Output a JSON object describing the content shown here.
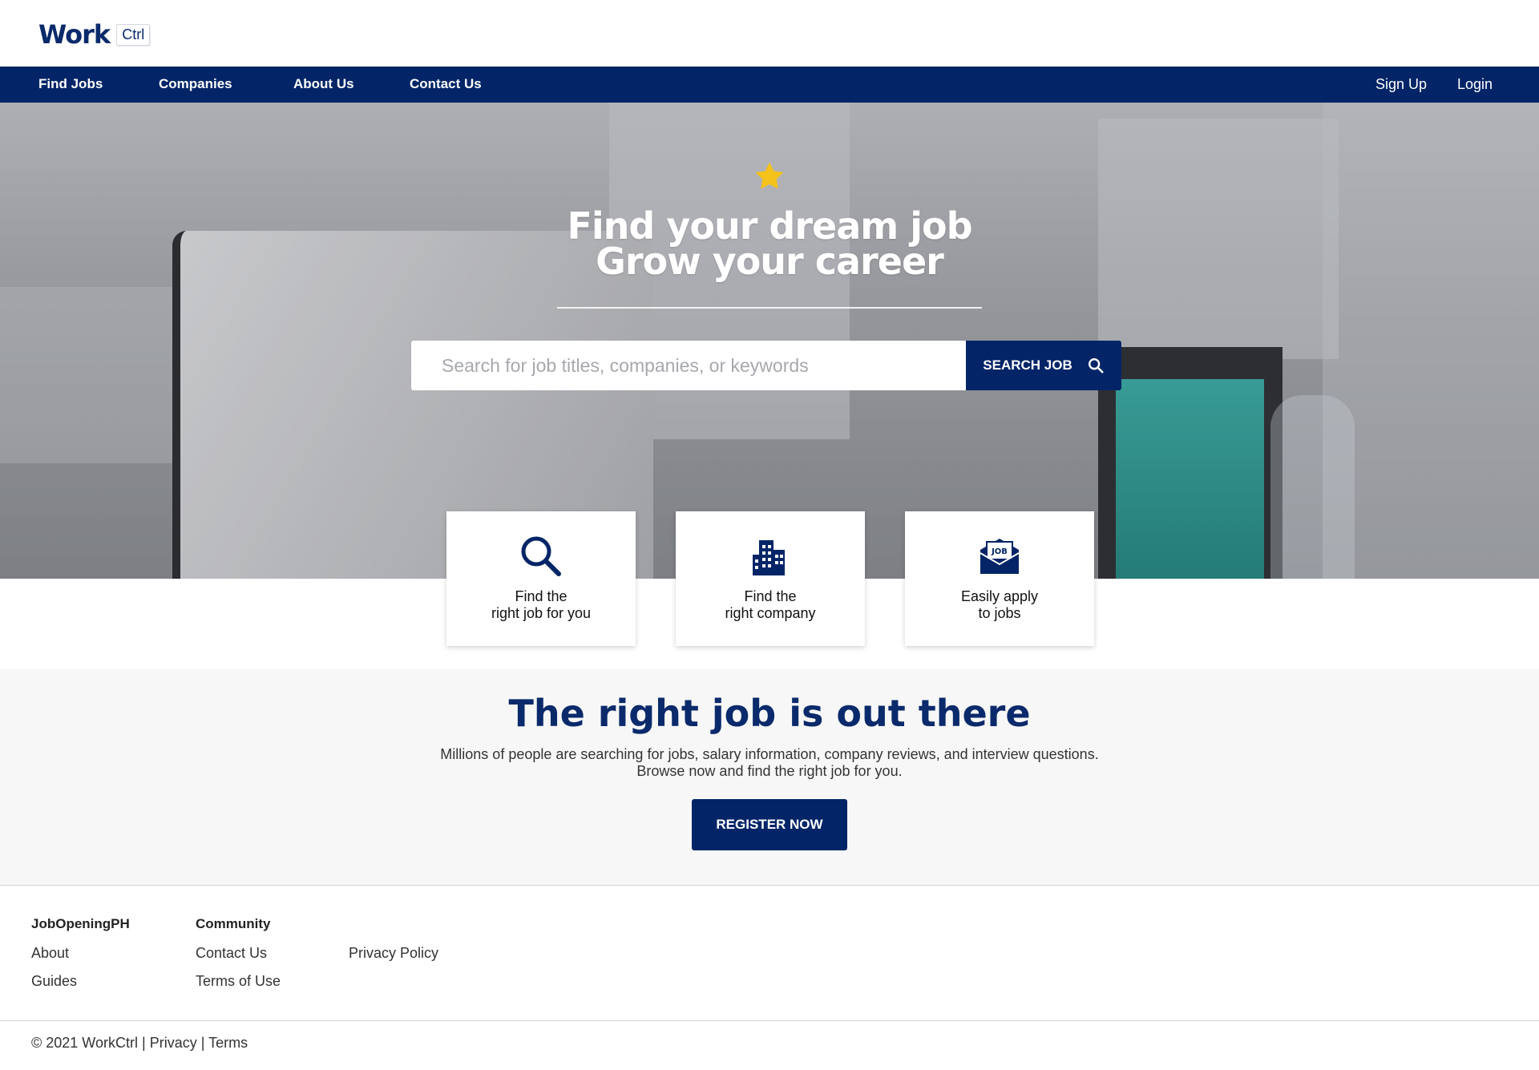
{
  "brand": {
    "name": "Work",
    "badge": "Ctrl"
  },
  "nav": {
    "items": [
      "Find Jobs",
      "Companies",
      "About Us",
      "Contact Us"
    ],
    "signup": "Sign Up",
    "login": "Login"
  },
  "hero": {
    "title_line1": "Find your dream job",
    "title_line2": "Grow your career",
    "search_placeholder": "Search for job titles, companies, or keywords",
    "search_button": "SEARCH JOB"
  },
  "features": [
    {
      "icon": "magnifier-icon",
      "label": "Find the\nright job for you"
    },
    {
      "icon": "building-icon",
      "label": "Find the\nright company"
    },
    {
      "icon": "job-envelope-icon",
      "label": "Easily apply\nto jobs",
      "badge": "JOB"
    }
  ],
  "promo": {
    "heading": "The right job is out there",
    "line1": "Millions of people are searching for jobs, salary information, company reviews, and interview questions.",
    "line2": "Browse now and find the right job for you.",
    "button": "REGISTER NOW"
  },
  "footer": {
    "col1": {
      "heading": "JobOpeningPH",
      "links": [
        "About",
        "Guides"
      ]
    },
    "col2": {
      "heading": "Community",
      "links": [
        "Contact Us",
        "Terms of Use"
      ]
    },
    "col3": {
      "links": [
        "Privacy Policy"
      ]
    },
    "copyright": "© 2021 WorkCtrl",
    "privacy": "Privacy",
    "terms": "Terms",
    "separator": "|"
  },
  "colors": {
    "primary": "#032567",
    "accent_star": "#f4c21a",
    "heading": "#0a2a6b"
  }
}
